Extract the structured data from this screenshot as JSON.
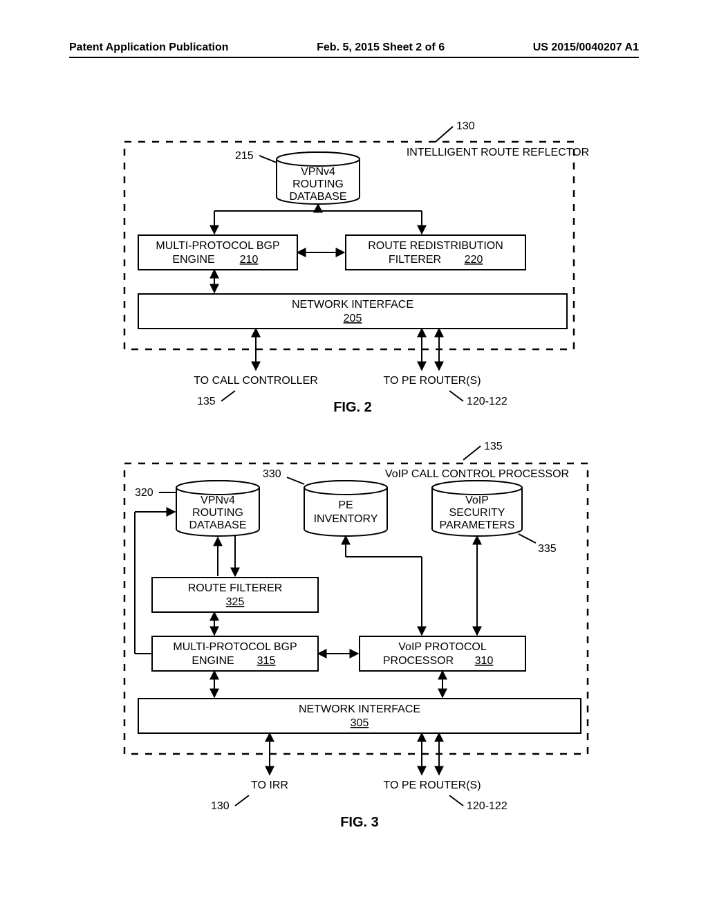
{
  "header": {
    "left": "Patent Application Publication",
    "center": "Feb. 5, 2015   Sheet 2 of 6",
    "right": "US 2015/0040207 A1"
  },
  "fig2": {
    "title": "FIG. 2",
    "container_label": "INTELLIGENT ROUTE REFLECTOR",
    "container_ref": "130",
    "db": {
      "l1": "VPNv4",
      "l2": "ROUTING",
      "l3": "DATABASE"
    },
    "db_ref": "215",
    "engine": {
      "l1": "MULTI-PROTOCOL BGP",
      "l2": "ENGINE",
      "num": "210"
    },
    "filterer": {
      "l1": "ROUTE REDISTRIBUTION",
      "l2": "FILTERER",
      "num": "220"
    },
    "net": {
      "l1": "NETWORK INTERFACE",
      "num": "205"
    },
    "out_left": "TO CALL CONTROLLER",
    "out_left_ref": "135",
    "out_right": "TO PE ROUTER(S)",
    "out_right_ref": "120-122"
  },
  "fig3": {
    "title": "FIG. 3",
    "container_label": "VoIP CALL CONTROL PROCESSOR",
    "container_ref": "135",
    "db1": {
      "l1": "VPNv4",
      "l2": "ROUTING",
      "l3": "DATABASE"
    },
    "db1_ref": "320",
    "db2": {
      "l1": "PE",
      "l2": "INVENTORY"
    },
    "db2_ref": "330",
    "db3": {
      "l1": "VoIP",
      "l2": "SECURITY",
      "l3": "PARAMETERS"
    },
    "db3_ref": "335",
    "route_filterer": {
      "l1": "ROUTE FILTERER",
      "num": "325"
    },
    "engine": {
      "l1": "MULTI-PROTOCOL BGP",
      "l2": "ENGINE",
      "num": "315"
    },
    "processor": {
      "l1": "VoIP PROTOCOL",
      "l2": "PROCESSOR",
      "num": "310"
    },
    "net": {
      "l1": "NETWORK INTERFACE",
      "num": "305"
    },
    "out_left": "TO IRR",
    "out_left_ref": "130",
    "out_right": "TO PE ROUTER(S)",
    "out_right_ref": "120-122"
  }
}
